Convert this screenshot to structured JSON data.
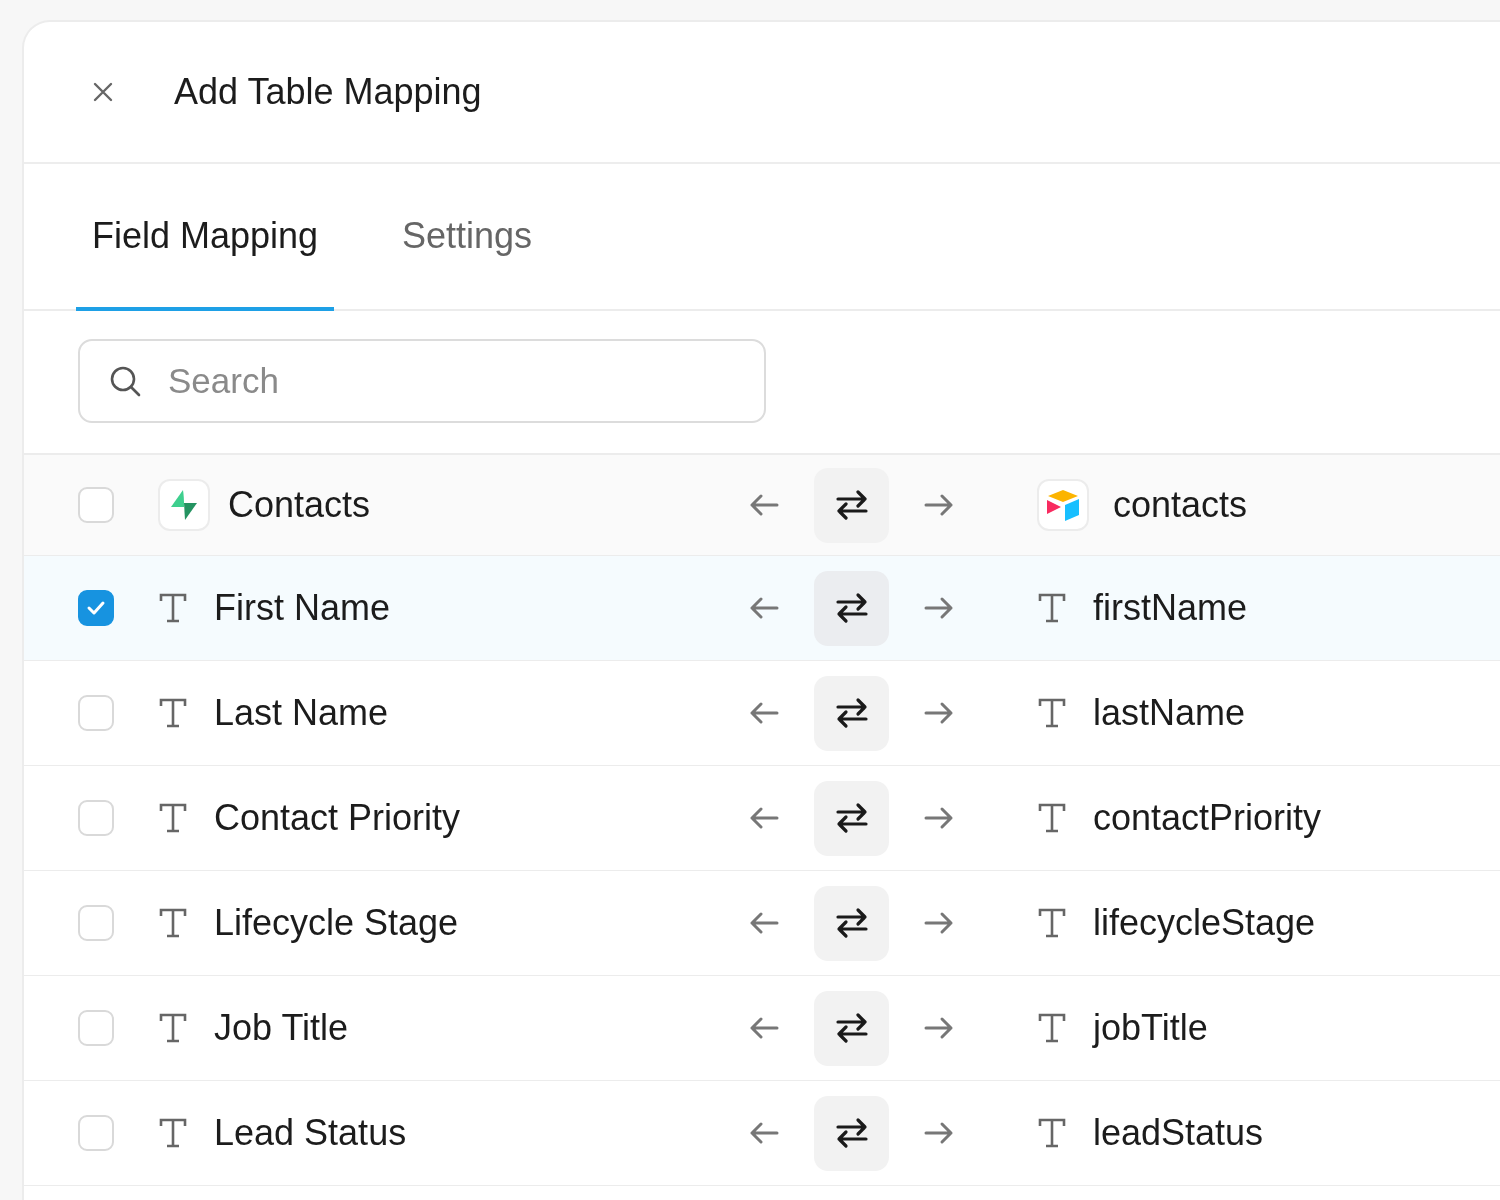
{
  "dialog": {
    "title": "Add Table Mapping"
  },
  "tabs": [
    {
      "label": "Field Mapping",
      "selected": true
    },
    {
      "label": "Settings",
      "selected": false
    }
  ],
  "search": {
    "placeholder": "Search"
  },
  "table_header": {
    "checked": false,
    "source": "Contacts",
    "target": "contacts"
  },
  "fields": [
    {
      "source": "First Name",
      "target": "firstName",
      "checked": true
    },
    {
      "source": "Last Name",
      "target": "lastName",
      "checked": false
    },
    {
      "source": "Contact Priority",
      "target": "contactPriority",
      "checked": false
    },
    {
      "source": "Lifecycle Stage",
      "target": "lifecycleStage",
      "checked": false
    },
    {
      "source": "Job Title",
      "target": "jobTitle",
      "checked": false
    },
    {
      "source": "Lead Status",
      "target": "leadStatus",
      "checked": false
    }
  ]
}
